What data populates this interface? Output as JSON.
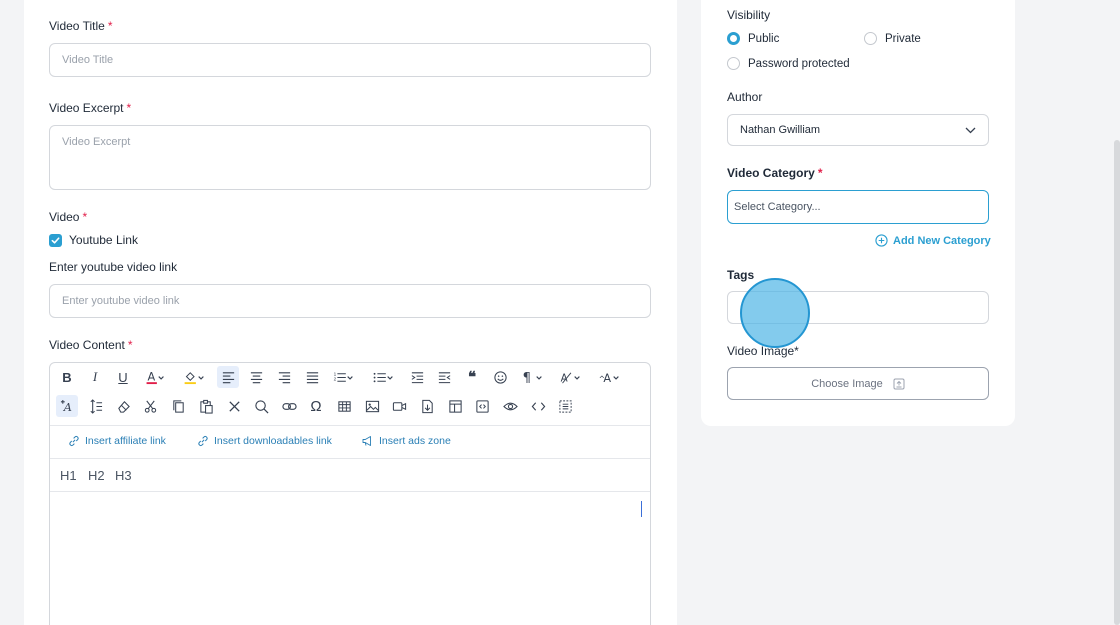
{
  "form": {
    "title_label": "Video Title",
    "title_placeholder": "Video Title",
    "excerpt_label": "Video Excerpt",
    "excerpt_placeholder": "Video Excerpt",
    "video_label": "Video",
    "youtube_checkbox_label": "Youtube Link",
    "youtube_checked": true,
    "youtube_link_label": "Enter youtube video link",
    "youtube_link_placeholder": "Enter youtube video link",
    "content_label": "Video Content",
    "required_mark": "*"
  },
  "editor": {
    "toolbar_row1": [
      "bold-icon",
      "italic-icon",
      "underline-icon",
      "font-color-icon",
      "highlight-color-icon",
      "align-left-icon",
      "align-center-icon",
      "align-right-icon",
      "align-justify-icon",
      "ordered-list-icon",
      "unordered-list-icon",
      "indent-icon",
      "outdent-icon",
      "blockquote-icon",
      "emoji-icon",
      "paragraph-icon",
      "line-height-icon",
      "font-size-icon"
    ],
    "toolbar_row2": [
      "format-painter-icon",
      "text-direction-icon",
      "eraser-icon",
      "cut-icon",
      "copy-icon",
      "paste-icon",
      "clear-format-icon",
      "search-icon",
      "link-icon",
      "special-char-icon",
      "table-icon",
      "image-icon",
      "video-icon",
      "file-icon",
      "template-icon",
      "code-view-icon",
      "preview-icon",
      "source-code-icon",
      "select-all-icon"
    ],
    "actions": {
      "affiliate": "Insert affiliate link",
      "downloadables": "Insert downloadables link",
      "ads": "Insert ads zone"
    },
    "headings": [
      "H1",
      "H2",
      "H3"
    ]
  },
  "sidebar": {
    "visibility_label": "Visibility",
    "visibility_options": [
      "Public",
      "Private",
      "Password protected"
    ],
    "visibility_selected": "Public",
    "author_label": "Author",
    "author_value": "Nathan Gwilliam",
    "category_label": "Video Category",
    "category_placeholder": "Select Category...",
    "add_category": "Add New Category",
    "tags_label": "Tags",
    "image_label": "Video Image*",
    "choose_image": "Choose Image"
  },
  "colors": {
    "accent": "#2b9fd1",
    "required": "#e11d48",
    "link": "#2a7fb5"
  }
}
